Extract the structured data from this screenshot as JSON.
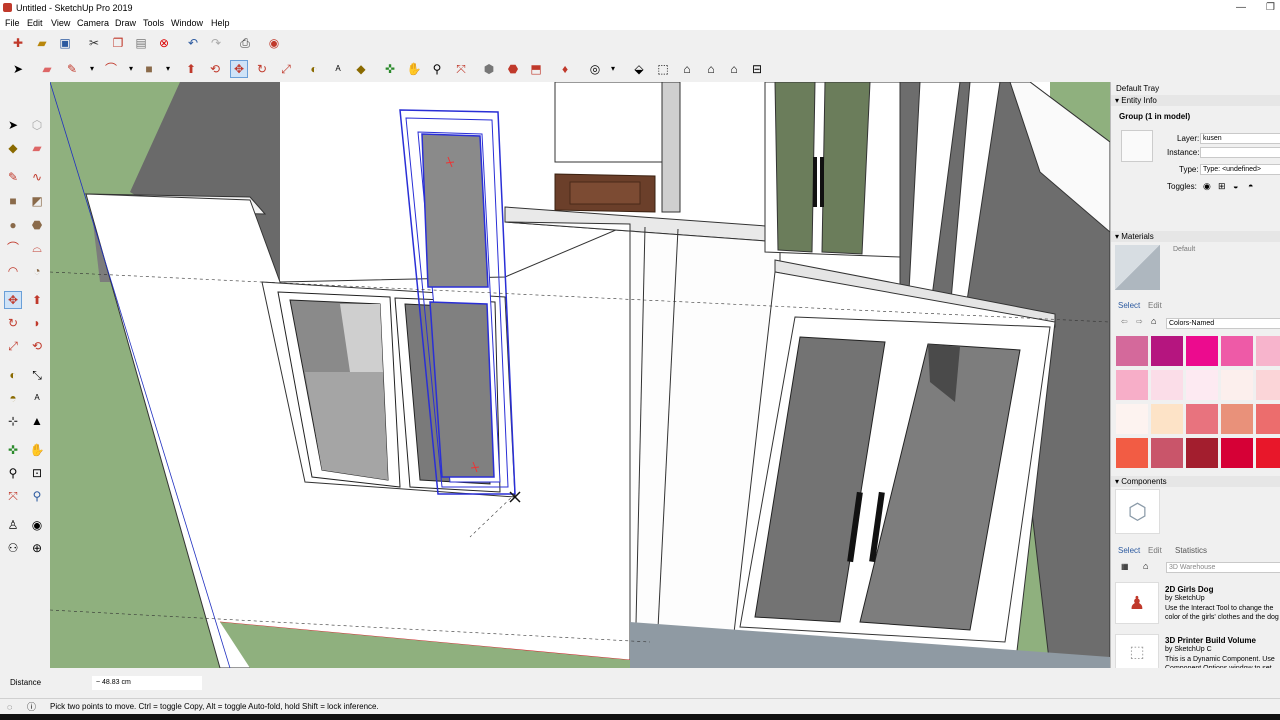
{
  "window": {
    "title": "Untitled - SketchUp Pro 2019"
  },
  "menu": [
    "File",
    "Edit",
    "View",
    "Camera",
    "Draw",
    "Tools",
    "Window",
    "Help"
  ],
  "tray": {
    "title": "Default Tray",
    "entity_info": {
      "header": "Entity Info",
      "object": "Group (1 in model)",
      "layer_label": "Layer:",
      "layer_value": "kusen",
      "instance_label": "Instance:",
      "instance_value": "",
      "type_label": "Type:",
      "type_value": "Type: <undefined>",
      "toggles_label": "Toggles:"
    },
    "materials": {
      "header": "Materials",
      "current": "Default",
      "tab_select": "Select",
      "tab_edit": "Edit",
      "library": "Colors-Named",
      "swatches": [
        "#d4699b",
        "#b5157f",
        "#ec0b8e",
        "#ee5aa7",
        "#f7b4cc",
        "#f7aec8",
        "#fbdde8",
        "#fdeaf2",
        "#fcefed",
        "#fbd5d8",
        "#fdf3f0",
        "#fde3c7",
        "#e8737e",
        "#e9917a",
        "#ec6d6d",
        "#f25c44",
        "#c9556a",
        "#a31e2e",
        "#d60036",
        "#e8172a"
      ]
    },
    "components": {
      "header": "Components",
      "tab_select": "Select",
      "tab_edit": "Edit",
      "tab_statistics": "Statistics",
      "search_placeholder": "3D Warehouse",
      "items": [
        {
          "title": "2D Girls Dog",
          "author": "by SketchUp",
          "desc": "Use the Interact Tool to change the color of the girls' clothes and the dog"
        },
        {
          "title": "3D Printer Build Volume",
          "author": "by SketchUp C",
          "desc": "This is a Dynamic Component. Use Component Options window to set th"
        }
      ]
    }
  },
  "measurements": {
    "label": "Distance",
    "value": "~ 48.83 cm"
  },
  "status": {
    "text": "Pick two points to move.  Ctrl = toggle Copy, Alt = toggle Auto-fold, hold Shift = lock inference."
  },
  "colors": {
    "selection": "#2a2fd6",
    "sky": "#ffffff",
    "ground": "#8fb07e",
    "accent": "#c0392b"
  }
}
